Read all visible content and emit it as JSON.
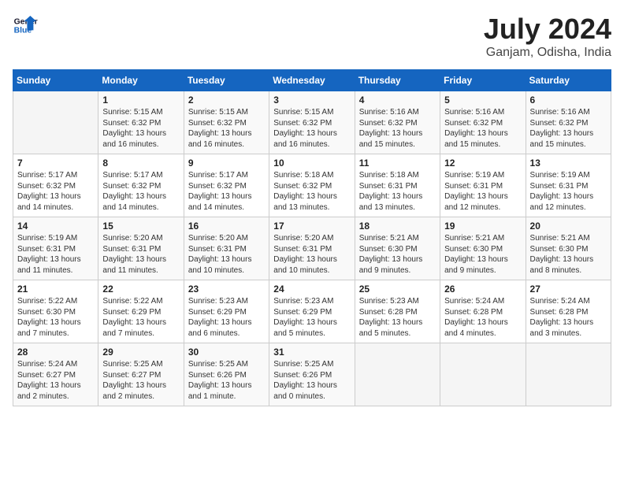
{
  "header": {
    "logo_line1": "General",
    "logo_line2": "Blue",
    "month": "July 2024",
    "location": "Ganjam, Odisha, India"
  },
  "weekdays": [
    "Sunday",
    "Monday",
    "Tuesday",
    "Wednesday",
    "Thursday",
    "Friday",
    "Saturday"
  ],
  "weeks": [
    [
      {
        "day": "",
        "info": ""
      },
      {
        "day": "1",
        "info": "Sunrise: 5:15 AM\nSunset: 6:32 PM\nDaylight: 13 hours\nand 16 minutes."
      },
      {
        "day": "2",
        "info": "Sunrise: 5:15 AM\nSunset: 6:32 PM\nDaylight: 13 hours\nand 16 minutes."
      },
      {
        "day": "3",
        "info": "Sunrise: 5:15 AM\nSunset: 6:32 PM\nDaylight: 13 hours\nand 16 minutes."
      },
      {
        "day": "4",
        "info": "Sunrise: 5:16 AM\nSunset: 6:32 PM\nDaylight: 13 hours\nand 15 minutes."
      },
      {
        "day": "5",
        "info": "Sunrise: 5:16 AM\nSunset: 6:32 PM\nDaylight: 13 hours\nand 15 minutes."
      },
      {
        "day": "6",
        "info": "Sunrise: 5:16 AM\nSunset: 6:32 PM\nDaylight: 13 hours\nand 15 minutes."
      }
    ],
    [
      {
        "day": "7",
        "info": "Sunrise: 5:17 AM\nSunset: 6:32 PM\nDaylight: 13 hours\nand 14 minutes."
      },
      {
        "day": "8",
        "info": "Sunrise: 5:17 AM\nSunset: 6:32 PM\nDaylight: 13 hours\nand 14 minutes."
      },
      {
        "day": "9",
        "info": "Sunrise: 5:17 AM\nSunset: 6:32 PM\nDaylight: 13 hours\nand 14 minutes."
      },
      {
        "day": "10",
        "info": "Sunrise: 5:18 AM\nSunset: 6:32 PM\nDaylight: 13 hours\nand 13 minutes."
      },
      {
        "day": "11",
        "info": "Sunrise: 5:18 AM\nSunset: 6:31 PM\nDaylight: 13 hours\nand 13 minutes."
      },
      {
        "day": "12",
        "info": "Sunrise: 5:19 AM\nSunset: 6:31 PM\nDaylight: 13 hours\nand 12 minutes."
      },
      {
        "day": "13",
        "info": "Sunrise: 5:19 AM\nSunset: 6:31 PM\nDaylight: 13 hours\nand 12 minutes."
      }
    ],
    [
      {
        "day": "14",
        "info": "Sunrise: 5:19 AM\nSunset: 6:31 PM\nDaylight: 13 hours\nand 11 minutes."
      },
      {
        "day": "15",
        "info": "Sunrise: 5:20 AM\nSunset: 6:31 PM\nDaylight: 13 hours\nand 11 minutes."
      },
      {
        "day": "16",
        "info": "Sunrise: 5:20 AM\nSunset: 6:31 PM\nDaylight: 13 hours\nand 10 minutes."
      },
      {
        "day": "17",
        "info": "Sunrise: 5:20 AM\nSunset: 6:31 PM\nDaylight: 13 hours\nand 10 minutes."
      },
      {
        "day": "18",
        "info": "Sunrise: 5:21 AM\nSunset: 6:30 PM\nDaylight: 13 hours\nand 9 minutes."
      },
      {
        "day": "19",
        "info": "Sunrise: 5:21 AM\nSunset: 6:30 PM\nDaylight: 13 hours\nand 9 minutes."
      },
      {
        "day": "20",
        "info": "Sunrise: 5:21 AM\nSunset: 6:30 PM\nDaylight: 13 hours\nand 8 minutes."
      }
    ],
    [
      {
        "day": "21",
        "info": "Sunrise: 5:22 AM\nSunset: 6:30 PM\nDaylight: 13 hours\nand 7 minutes."
      },
      {
        "day": "22",
        "info": "Sunrise: 5:22 AM\nSunset: 6:29 PM\nDaylight: 13 hours\nand 7 minutes."
      },
      {
        "day": "23",
        "info": "Sunrise: 5:23 AM\nSunset: 6:29 PM\nDaylight: 13 hours\nand 6 minutes."
      },
      {
        "day": "24",
        "info": "Sunrise: 5:23 AM\nSunset: 6:29 PM\nDaylight: 13 hours\nand 5 minutes."
      },
      {
        "day": "25",
        "info": "Sunrise: 5:23 AM\nSunset: 6:28 PM\nDaylight: 13 hours\nand 5 minutes."
      },
      {
        "day": "26",
        "info": "Sunrise: 5:24 AM\nSunset: 6:28 PM\nDaylight: 13 hours\nand 4 minutes."
      },
      {
        "day": "27",
        "info": "Sunrise: 5:24 AM\nSunset: 6:28 PM\nDaylight: 13 hours\nand 3 minutes."
      }
    ],
    [
      {
        "day": "28",
        "info": "Sunrise: 5:24 AM\nSunset: 6:27 PM\nDaylight: 13 hours\nand 2 minutes."
      },
      {
        "day": "29",
        "info": "Sunrise: 5:25 AM\nSunset: 6:27 PM\nDaylight: 13 hours\nand 2 minutes."
      },
      {
        "day": "30",
        "info": "Sunrise: 5:25 AM\nSunset: 6:26 PM\nDaylight: 13 hours\nand 1 minute."
      },
      {
        "day": "31",
        "info": "Sunrise: 5:25 AM\nSunset: 6:26 PM\nDaylight: 13 hours\nand 0 minutes."
      },
      {
        "day": "",
        "info": ""
      },
      {
        "day": "",
        "info": ""
      },
      {
        "day": "",
        "info": ""
      }
    ]
  ]
}
